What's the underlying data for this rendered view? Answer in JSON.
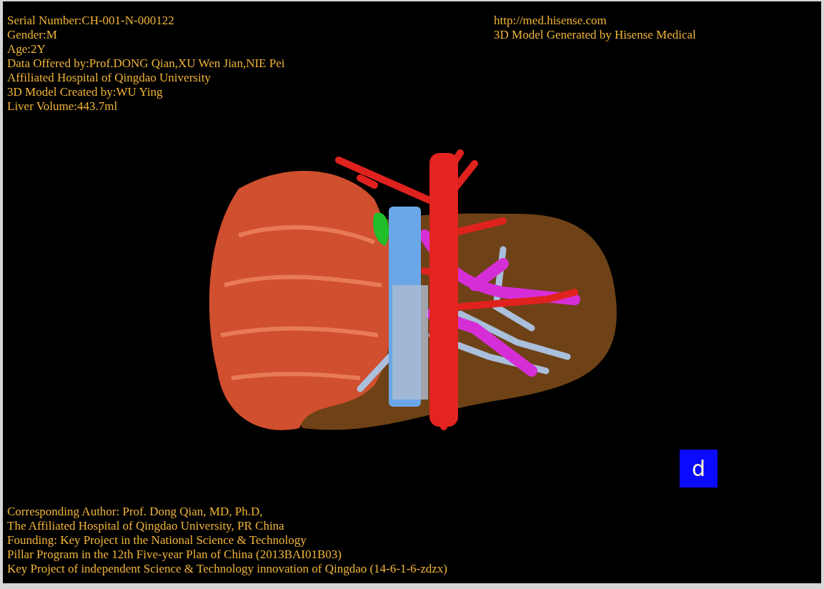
{
  "patient_info": [
    "Serial Number:CH-001-N-000122",
    "Gender:M",
    "Age:2Y",
    "Data Offered by:Prof.DONG Qian,XU Wen Jian,NIE Pei",
    "Affiliated Hospital of Qingdao University",
    "3D Model Created by:WU Ying",
    "Liver Volume:443.7ml"
  ],
  "generator_info": [
    "http://med.hisense.com",
    "3D Model Generated by Hisense Medical"
  ],
  "credits": [
    "Corresponding Author: Prof. Dong Qian, MD, Ph.D,",
    "The Affiliated Hospital of Qingdao University, PR China",
    "Founding: Key Project in the National Science & Technology",
    "Pillar Program in the 12th Five-year Plan of China (2013BAI01B03)",
    "Key Project of independent Science & Technology innovation of Qingdao (14-6-1-6-zdzx)"
  ],
  "orientation_marker": "d"
}
